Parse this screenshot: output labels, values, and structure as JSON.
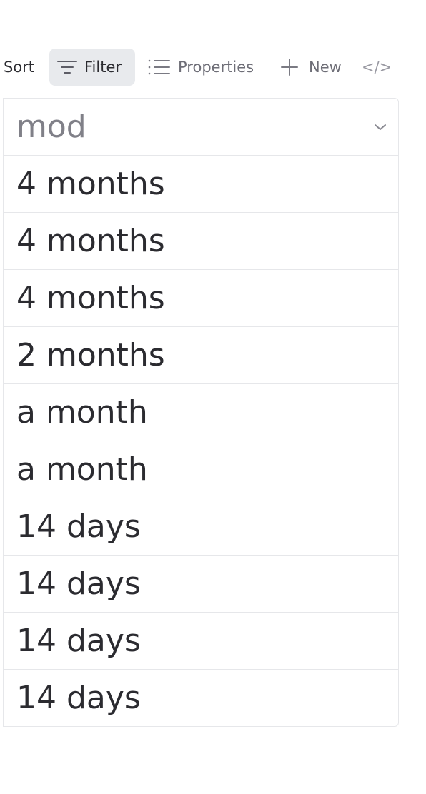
{
  "toolbar": {
    "sort_label": "Sort",
    "filter_label": "Filter",
    "properties_label": "Properties",
    "new_label": "New",
    "code_label": "</>"
  },
  "table": {
    "column_header": "mod",
    "rows": [
      "4 months",
      "4 months",
      "4 months",
      "2 months",
      "a month",
      "a month",
      "14 days",
      "14 days",
      "14 days",
      "14 days"
    ]
  },
  "colors": {
    "text": "#2b2b30",
    "muted": "#6e6e77",
    "header": "#808088",
    "border": "#e6e7ea",
    "filter_bg": "#e8eaed"
  },
  "icons": [
    "filter-icon",
    "list-icon",
    "plus-icon",
    "code-icon",
    "chevron-down-icon"
  ]
}
